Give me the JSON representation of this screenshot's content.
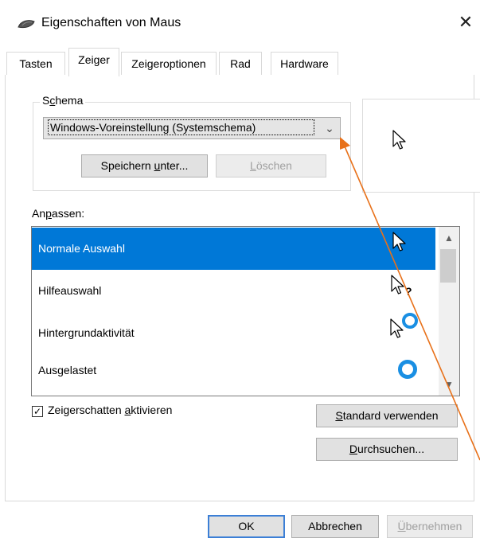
{
  "window": {
    "title": "Eigenschaften von Maus",
    "close_glyph": "✕"
  },
  "tabs": [
    {
      "label": "Tasten",
      "selected": false
    },
    {
      "label": "Zeiger",
      "selected": true
    },
    {
      "label": "Zeigeroptionen",
      "selected": false
    },
    {
      "label": "Rad",
      "selected": false
    },
    {
      "label": "Hardware",
      "selected": false
    }
  ],
  "schema": {
    "label_pre": "S",
    "label_ul": "c",
    "label_post": "hema",
    "selected_value": "Windows-Voreinstellung (Systemschema)",
    "save_pre": "Speichern ",
    "save_ul": "u",
    "save_post": "nter...",
    "delete_pre": "",
    "delete_ul": "L",
    "delete_post": "öschen"
  },
  "customize": {
    "label_pre": "An",
    "label_ul": "p",
    "label_post": "assen:",
    "items": [
      {
        "label": "Normale Auswahl",
        "icon": "arrow-cursor-icon",
        "selected": true
      },
      {
        "label": "Hilfeauswahl",
        "icon": "help-cursor-icon",
        "selected": false
      },
      {
        "label": "Hintergrundaktivität",
        "icon": "working-in-background-cursor-icon",
        "selected": false
      },
      {
        "label": "Ausgelastet",
        "icon": "busy-cursor-icon",
        "selected": false
      }
    ]
  },
  "shadow": {
    "checked": true,
    "label_pre": "Zeigerschatten ",
    "label_ul": "a",
    "label_post": "ktivieren"
  },
  "buttons": {
    "default_pre": "",
    "default_ul": "S",
    "default_post": "tandard verwenden",
    "browse_pre": "",
    "browse_ul": "D",
    "browse_post": "urchsuchen...",
    "ok": "OK",
    "cancel": "Abbrechen",
    "apply_pre": "",
    "apply_ul": "Ü",
    "apply_post": "bernehmen"
  },
  "colors": {
    "accent": "#0078d7",
    "annotation": "#e8711a",
    "busy_ring": "#1a8fe3"
  }
}
